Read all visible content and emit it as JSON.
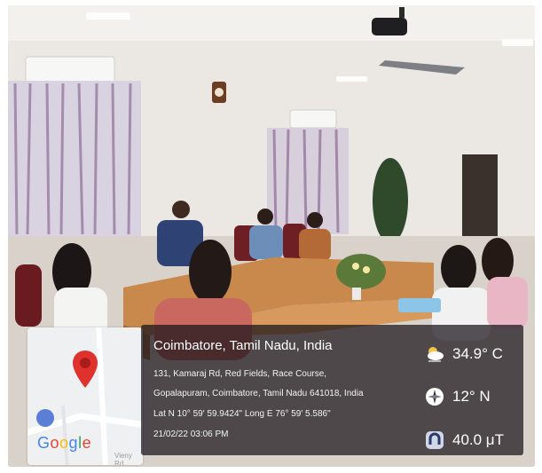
{
  "location_overlay": {
    "city": "Coimbatore, Tamil Nadu, India",
    "address_line1": "131, Kamaraj Rd, Red Fields, Race Course,",
    "address_line2": "Gopalapuram, Coimbatore, Tamil Nadu 641018, India",
    "coordinates": "Lat N 10° 59' 59.9424\" Long E 76° 59' 5.586\"",
    "timestamp": "21/02/22 03:06 PM",
    "temperature": "34.9° C",
    "temperature_icon": "weather-cloud-icon",
    "compass": "12° N",
    "compass_icon": "compass-icon",
    "magnetic_field": "40.0 μT",
    "magnetic_icon": "magnet-icon"
  },
  "map_card": {
    "brand": "Google",
    "brand_colors": [
      "#4285F4",
      "#EA4335",
      "#FBBC05",
      "#4285F4",
      "#34A853",
      "#EA4335"
    ],
    "road_label": "Vieny Rd",
    "pin_icon": "map-pin-icon",
    "pin_color": "#e0322c"
  }
}
